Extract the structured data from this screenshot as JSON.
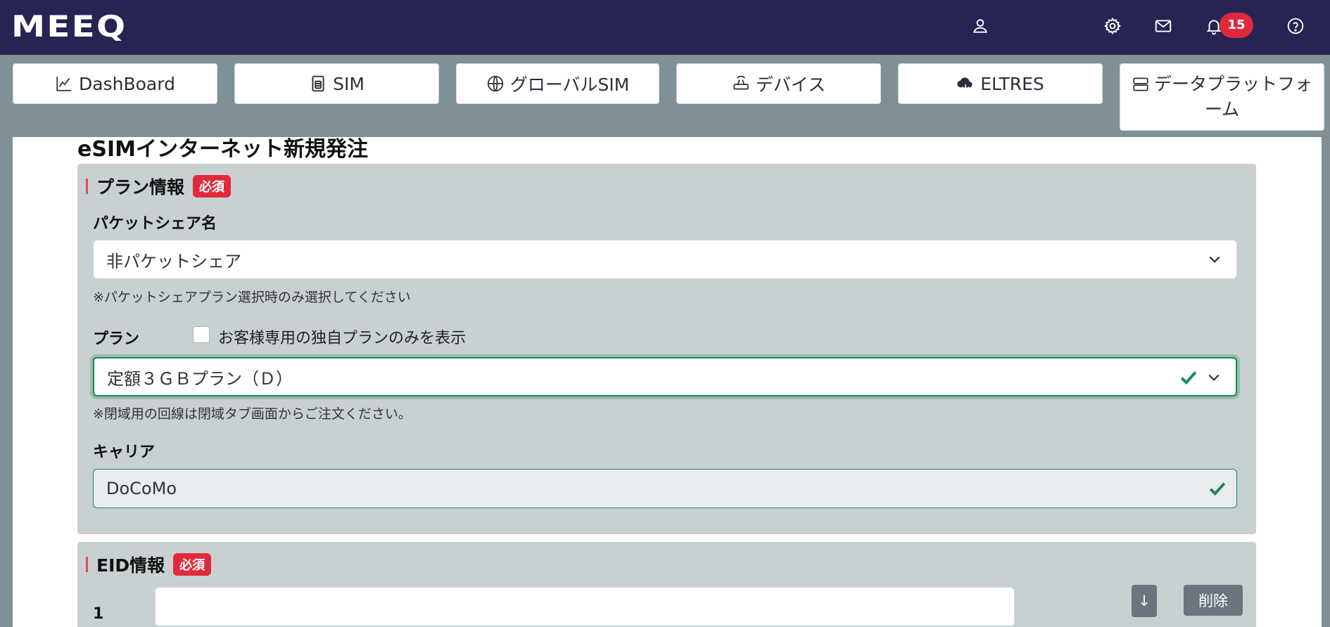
{
  "header": {
    "logo": "MEEQ",
    "notification_count": "15",
    "icons": [
      "user-icon",
      "gear-icon",
      "mail-icon",
      "bell-icon",
      "help-icon"
    ]
  },
  "nav": {
    "dashboard": "DashBoard",
    "sim": "SIM",
    "global_sim": "グローバルSIM",
    "device": "デバイス",
    "eltres": "ELTRES",
    "data_platform_line1": "データプラットフォ",
    "data_platform_line2": "ーム"
  },
  "page": {
    "title": "eSIMインターネット新規発注"
  },
  "plan_section": {
    "title": "プラン情報",
    "required": "必須",
    "packet_share_label": "パケットシェア名",
    "packet_share_value": "非パケットシェア",
    "packet_share_note": "※パケットシェアプラン選択時のみ選択してください",
    "plan_label": "プラン",
    "custom_plan_checkbox": "お客様専用の独自プランのみを表示",
    "plan_value": "定額３ＧＢプラン（Ｄ）",
    "plan_note": "※閉域用の回線は閉域タブ画面からご注文ください。",
    "carrier_label": "キャリア",
    "carrier_value": "DoCoMo"
  },
  "eid_section": {
    "title": "EID情報",
    "required": "必須",
    "row_number": "1",
    "down_button": "↓",
    "delete_button": "削除"
  },
  "colors": {
    "topbar": "#272454",
    "required_badge": "#e02a3c",
    "valid_green": "#198754"
  }
}
